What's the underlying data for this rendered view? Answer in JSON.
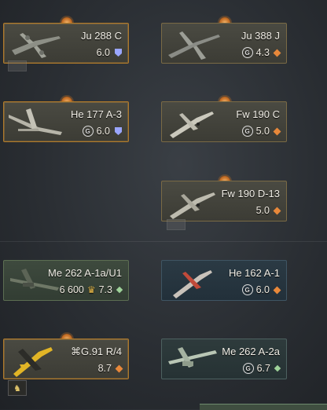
{
  "cards": [
    {
      "name": "Ju 288 C",
      "br": "6.0",
      "rank": "shield",
      "gift": false,
      "crown": "",
      "cost": ""
    },
    {
      "name": "Ju 388 J",
      "br": "4.3",
      "rank": "diamond",
      "gift": true,
      "crown": "",
      "cost": ""
    },
    {
      "name": "He 177 A-3",
      "br": "6.0",
      "rank": "shield",
      "gift": true,
      "crown": "",
      "cost": ""
    },
    {
      "name": "Fw 190 C",
      "br": "5.0",
      "rank": "diamond",
      "gift": true,
      "crown": "",
      "cost": ""
    },
    {
      "name": "Fw 190 D-13",
      "br": "5.0",
      "rank": "diamond",
      "gift": false,
      "crown": "",
      "cost": ""
    },
    {
      "name": "Me 262 A-1a/U1",
      "br": "7.3",
      "rank": "green-diamond",
      "gift": false,
      "crown": "crown",
      "cost": "6 600"
    },
    {
      "name": "He 162 A-1",
      "br": "6.0",
      "rank": "diamond",
      "gift": true,
      "crown": "",
      "cost": ""
    },
    {
      "name": "⌘G.91 R/4",
      "br": "8.7",
      "rank": "diamond",
      "gift": false,
      "crown": "",
      "cost": ""
    },
    {
      "name": "Me 262 A-2a",
      "br": "6.7",
      "rank": "green-diamond",
      "gift": true,
      "crown": "",
      "cost": ""
    }
  ]
}
